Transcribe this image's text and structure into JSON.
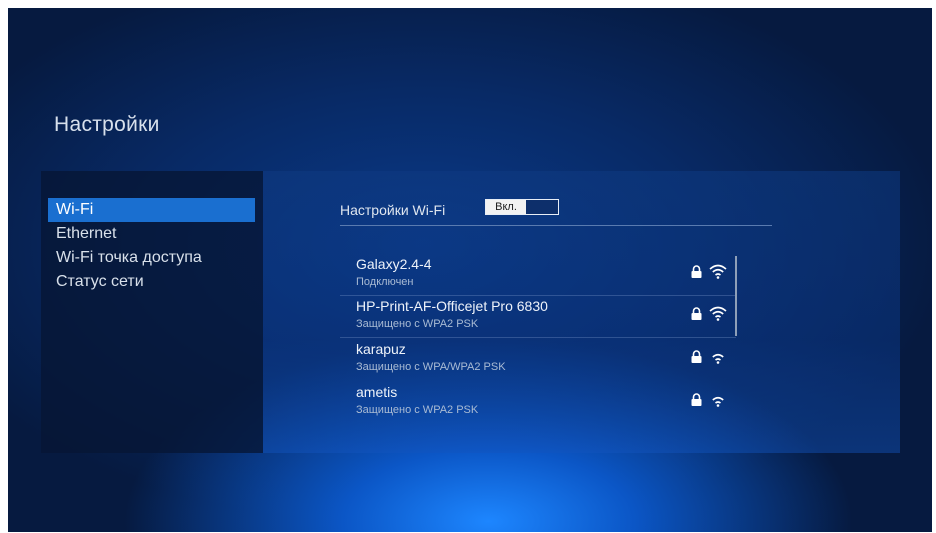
{
  "page": {
    "title": "Настройки"
  },
  "sidebar": {
    "items": [
      {
        "label": "Wi-Fi",
        "active": true
      },
      {
        "label": "Ethernet",
        "active": false
      },
      {
        "label": "Wi-Fi точка доступа",
        "active": false
      },
      {
        "label": "Статус сети",
        "active": false
      }
    ]
  },
  "wifi": {
    "settings_label": "Настройки Wi-Fi",
    "toggle_label": "Вкл.",
    "networks": [
      {
        "name": "Galaxy2.4-4",
        "status": "Подключен",
        "secured_icon": "lock-icon",
        "signal_icon": "wifi-signal-icon"
      },
      {
        "name": "HP-Print-AF-Officejet Pro 6830",
        "status": "Защищено с WPA2 PSK",
        "secured_icon": "lock-icon",
        "signal_icon": "wifi-signal-icon"
      },
      {
        "name": "karapuz",
        "status": "Защищено с WPA/WPA2 PSK",
        "secured_icon": "lock-icon",
        "signal_icon": "wifi-signal-icon"
      },
      {
        "name": "ametis",
        "status": "Защищено с WPA2 PSK",
        "secured_icon": "lock-icon",
        "signal_icon": "wifi-signal-icon"
      }
    ]
  },
  "colors": {
    "accent": "#1a6fd0",
    "background": "#082a66"
  }
}
